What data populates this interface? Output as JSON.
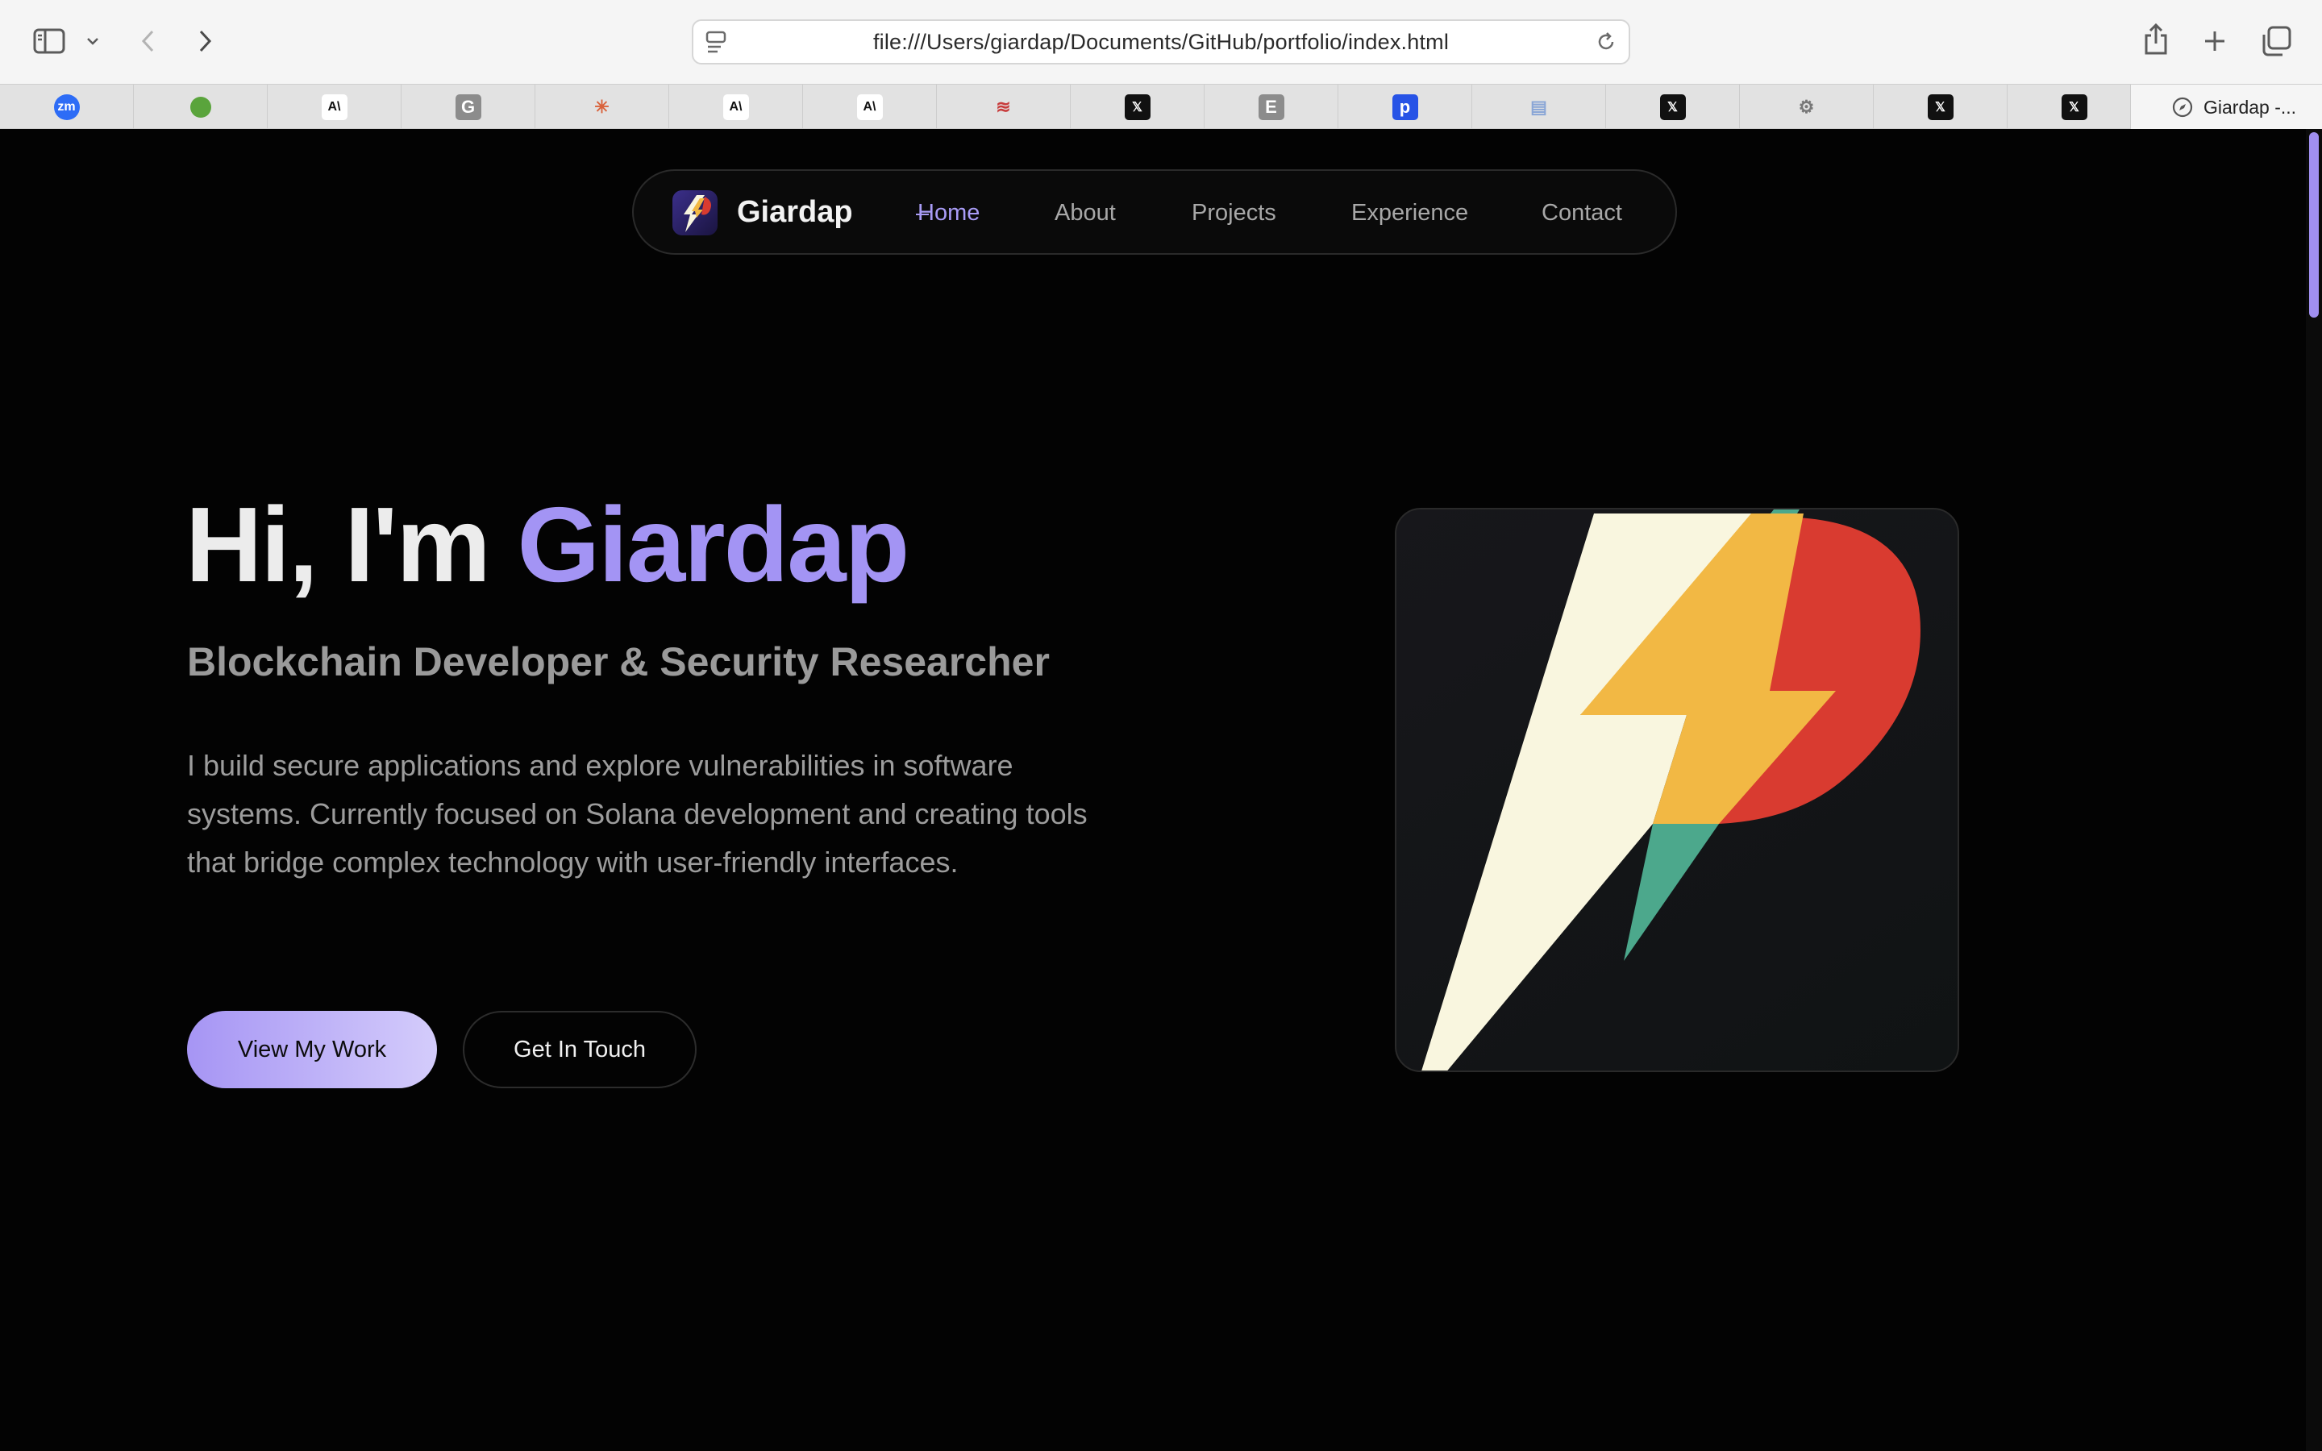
{
  "browser": {
    "url": "file:///Users/giardap/Documents/GitHub/portfolio/index.html",
    "active_tab_title": "Giardap -...",
    "pinned_tabs": [
      {
        "icon": "zoom-icon",
        "glyph": "zm",
        "bg": "#2d6cf6",
        "fg": "#ffffff"
      },
      {
        "icon": "green-blob-icon",
        "glyph": "",
        "bg": "#5aa43c",
        "fg": "#ffffff"
      },
      {
        "icon": "anthropic-icon",
        "glyph": "A\\",
        "bg": "#ffffff",
        "fg": "#111111"
      },
      {
        "icon": "g-letter-icon",
        "glyph": "G",
        "bg": "#8c8c8c",
        "fg": "#ffffff"
      },
      {
        "icon": "claude-burst-icon",
        "glyph": "✳",
        "bg": "transparent",
        "fg": "#d9623b"
      },
      {
        "icon": "anthropic-icon",
        "glyph": "A\\",
        "bg": "#ffffff",
        "fg": "#111111"
      },
      {
        "icon": "anthropic-icon",
        "glyph": "A\\",
        "bg": "#ffffff",
        "fg": "#111111"
      },
      {
        "icon": "flag-icon",
        "glyph": "≋",
        "bg": "transparent",
        "fg": "#c83c3c"
      },
      {
        "icon": "x-logo-icon",
        "glyph": "𝕏",
        "bg": "#111111",
        "fg": "#ffffff"
      },
      {
        "icon": "e-letter-icon",
        "glyph": "E",
        "bg": "#8c8c8c",
        "fg": "#ffffff"
      },
      {
        "icon": "p-letter-icon",
        "glyph": "p",
        "bg": "#2753e6",
        "fg": "#ffffff"
      },
      {
        "icon": "document-icon",
        "glyph": "▤",
        "bg": "transparent",
        "fg": "#8aa6d6"
      },
      {
        "icon": "x-logo-icon",
        "glyph": "𝕏",
        "bg": "#111111",
        "fg": "#ffffff"
      },
      {
        "icon": "openai-icon",
        "glyph": "⚙",
        "bg": "transparent",
        "fg": "#777777"
      },
      {
        "icon": "x-logo-icon",
        "glyph": "𝕏",
        "bg": "#111111",
        "fg": "#ffffff"
      },
      {
        "icon": "x-logo-icon",
        "glyph": "𝕏",
        "bg": "#111111",
        "fg": "#ffffff"
      }
    ]
  },
  "nav": {
    "brand": "Giardap",
    "links": [
      "Home",
      "About",
      "Projects",
      "Experience",
      "Contact"
    ],
    "active": "Home"
  },
  "hero": {
    "title_prefix": "Hi, I'm ",
    "title_name": "Giardap",
    "subtitle": "Blockchain Developer & Security Researcher",
    "description": "I build secure applications and explore vulnerabilities in software systems. Currently focused on Solana development and creating tools that bridge complex technology with user-friendly interfaces.",
    "primary_button": "View My Work",
    "secondary_button": "Get In Touch"
  },
  "colors": {
    "accent": "#a394f4",
    "bolt_cream": "#f9f6df",
    "bolt_yellow": "#f2b844",
    "p_red": "#d93b30",
    "bolt_teal": "#4ca88c"
  }
}
